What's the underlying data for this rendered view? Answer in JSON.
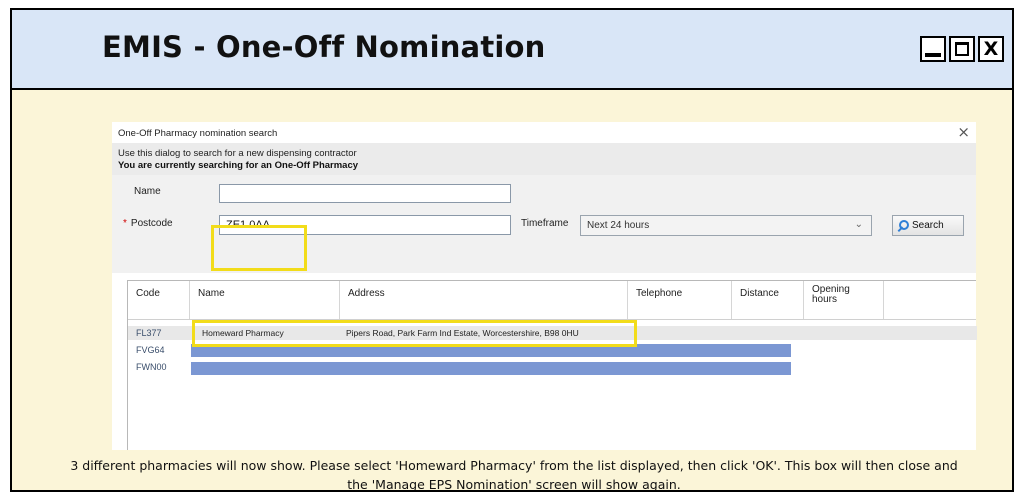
{
  "window": {
    "title": "EMIS - One-Off Nomination",
    "controls": {
      "minimize_icon": "minimize-icon",
      "maximize_icon": "maximize-icon",
      "close_label": "X"
    }
  },
  "dialog": {
    "title": "One-Off Pharmacy nomination search",
    "close_label": "×",
    "info_line1": "Use this dialog to search for a new dispensing contractor",
    "info_line2": "You are currently searching for an One-Off Pharmacy",
    "form": {
      "name_label": "Name",
      "name_value": "",
      "postcode_required_marker": "*",
      "postcode_label": "Postcode",
      "postcode_value": "ZE1 0AA",
      "timeframe_label": "Timeframe",
      "timeframe_value": "Next 24 hours",
      "search_label": "Search"
    },
    "results": {
      "columns": [
        "Code",
        "Name",
        "Address",
        "Telephone",
        "Distance",
        "Opening hours"
      ],
      "rows": [
        {
          "code": "FL377",
          "name": "Homeward Pharmacy",
          "address": "Pipers Road, Park Farm Ind Estate, Worcestershire, B98 0HU",
          "telephone": "",
          "distance": "",
          "opening_hours": "",
          "selected": true
        },
        {
          "code": "FVG64",
          "redacted": true
        },
        {
          "code": "FWN00",
          "redacted": true
        }
      ]
    }
  },
  "instructions": {
    "line1": "3 different pharmacies will now show. Please select 'Homeward Pharmacy' from the list displayed, then click 'OK'. This box will then close and",
    "line2": "the 'Manage EPS Nomination' screen will show again."
  },
  "colors": {
    "title_bar": "#d9e6f7",
    "background": "#fbf5d8",
    "highlight": "#f2dc1a",
    "redaction_bar": "#7b97d3"
  }
}
